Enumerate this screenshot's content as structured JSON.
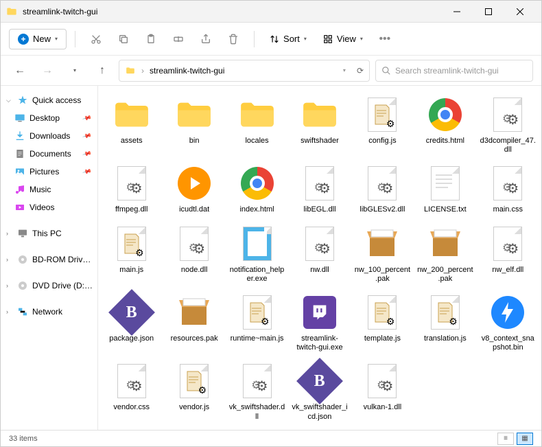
{
  "window": {
    "title": "streamlink-twitch-gui"
  },
  "toolbar": {
    "new_label": "New",
    "sort_label": "Sort",
    "view_label": "View"
  },
  "breadcrumb": {
    "path": "streamlink-twitch-gui"
  },
  "search": {
    "placeholder": "Search streamlink-twitch-gui"
  },
  "sidebar": {
    "quick_access": "Quick access",
    "desktop": "Desktop",
    "downloads": "Downloads",
    "documents": "Documents",
    "pictures": "Pictures",
    "music": "Music",
    "videos": "Videos",
    "this_pc": "This PC",
    "bd_rom": "BD-ROM Drive (E:) C",
    "dvd": "DVD Drive (D:) CCCC",
    "network": "Network"
  },
  "files": [
    {
      "name": "assets",
      "type": "folder"
    },
    {
      "name": "bin",
      "type": "folder"
    },
    {
      "name": "locales",
      "type": "folder"
    },
    {
      "name": "swiftshader",
      "type": "folder"
    },
    {
      "name": "config.js",
      "type": "js"
    },
    {
      "name": "credits.html",
      "type": "chrome"
    },
    {
      "name": "d3dcompiler_47.dll",
      "type": "dll"
    },
    {
      "name": "ffmpeg.dll",
      "type": "dll"
    },
    {
      "name": "icudtl.dat",
      "type": "dat"
    },
    {
      "name": "index.html",
      "type": "chrome"
    },
    {
      "name": "libEGL.dll",
      "type": "dll"
    },
    {
      "name": "libGLESv2.dll",
      "type": "dll"
    },
    {
      "name": "LICENSE.txt",
      "type": "txt"
    },
    {
      "name": "main.css",
      "type": "dll"
    },
    {
      "name": "main.js",
      "type": "js"
    },
    {
      "name": "node.dll",
      "type": "dll"
    },
    {
      "name": "notification_helper.exe",
      "type": "exe"
    },
    {
      "name": "nw.dll",
      "type": "dll"
    },
    {
      "name": "nw_100_percent.pak",
      "type": "pak"
    },
    {
      "name": "nw_200_percent.pak",
      "type": "pak"
    },
    {
      "name": "nw_elf.dll",
      "type": "dll"
    },
    {
      "name": "package.json",
      "type": "json"
    },
    {
      "name": "resources.pak",
      "type": "pak"
    },
    {
      "name": "runtime~main.js",
      "type": "js"
    },
    {
      "name": "streamlink-twitch-gui.exe",
      "type": "twitch"
    },
    {
      "name": "template.js",
      "type": "js"
    },
    {
      "name": "translation.js",
      "type": "js"
    },
    {
      "name": "v8_context_snapshot.bin",
      "type": "bin"
    },
    {
      "name": "vendor.css",
      "type": "dll"
    },
    {
      "name": "vendor.js",
      "type": "js"
    },
    {
      "name": "vk_swiftshader.dll",
      "type": "dll"
    },
    {
      "name": "vk_swiftshader_icd.json",
      "type": "json"
    },
    {
      "name": "vulkan-1.dll",
      "type": "dll"
    }
  ],
  "statusbar": {
    "count": "33 items"
  }
}
